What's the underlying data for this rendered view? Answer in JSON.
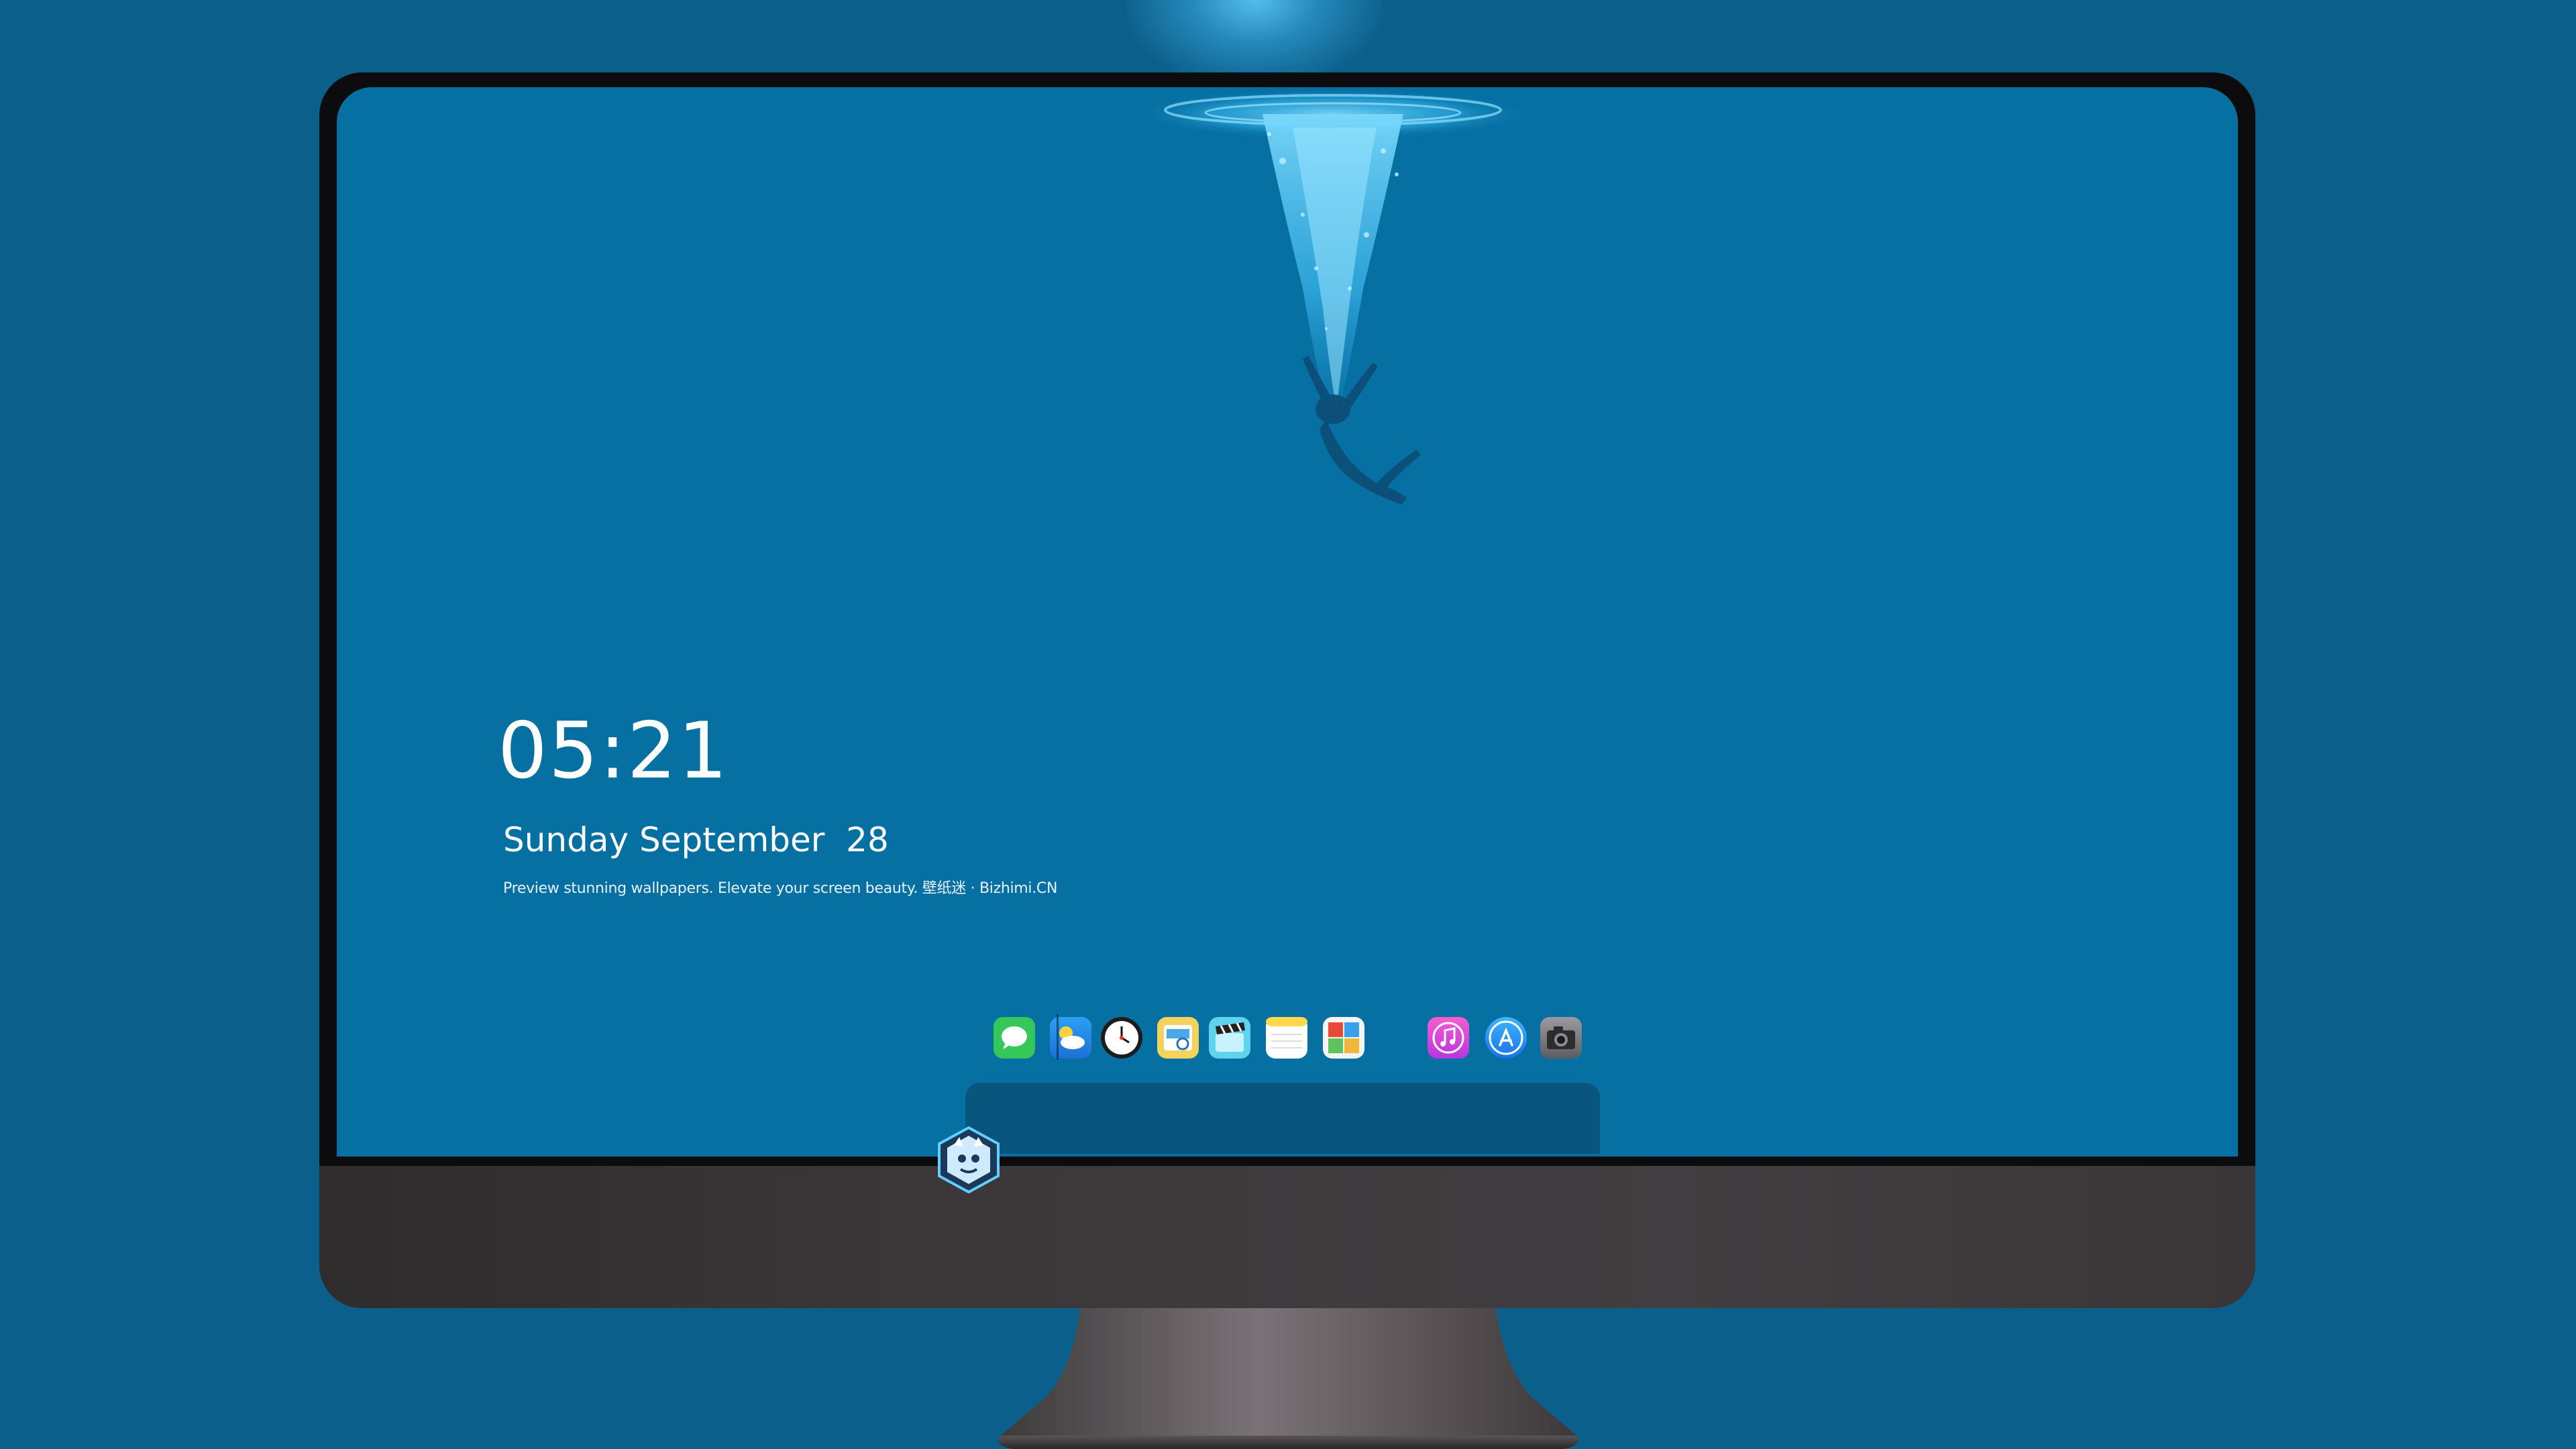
{
  "lockscreen": {
    "time": "05:21",
    "date": "Sunday September  28",
    "tagline": "Preview stunning wallpapers. Elevate your screen beauty. 壁纸迷 · Bizhimi.CN"
  },
  "dock": {
    "apps": [
      {
        "name": "messages-icon",
        "color": "#35c759"
      },
      {
        "name": "weather-icon",
        "color": "#2b8cf0"
      },
      {
        "name": "clock-icon",
        "color": "#1c1c1e"
      },
      {
        "name": "preview-icon",
        "color": "#f2c94c"
      },
      {
        "name": "clips-icon",
        "color": "#5fd3ee"
      },
      {
        "name": "notes-icon",
        "color": "#ffd84d"
      },
      {
        "name": "photo-booth-icon",
        "color": "#e84a3a"
      },
      {
        "name": "itunes-icon",
        "color": "#d43bd8"
      },
      {
        "name": "app-store-icon",
        "color": "#1f8ff5"
      },
      {
        "name": "camera-icon",
        "color": "#6e6e73"
      }
    ]
  },
  "colors": {
    "background": "#0a5f8b",
    "screen": "#0670a3",
    "monitor_body": "#3c393b",
    "splash": "#49c6f2"
  }
}
